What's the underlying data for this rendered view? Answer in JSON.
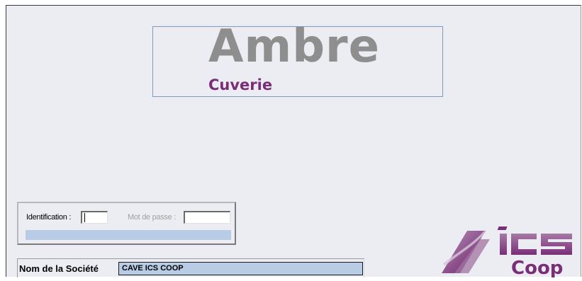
{
  "splash": {
    "logo": {
      "title": "Ambre",
      "subtitle": "Cuverie"
    },
    "login": {
      "identification_label": "Identification :",
      "identification_value": "",
      "password_label": "Mot de passe :",
      "password_value": ""
    },
    "company": {
      "label": "Nom de la Société",
      "value": "CAVE ICS COOP"
    },
    "brand": {
      "line1": "ICS",
      "line2": "Coop"
    }
  },
  "colors": {
    "background": "#ecedf3",
    "accent_purple": "#7a2e78",
    "logo_gray": "#8e8e8e",
    "field_blue": "#b8cce6"
  }
}
